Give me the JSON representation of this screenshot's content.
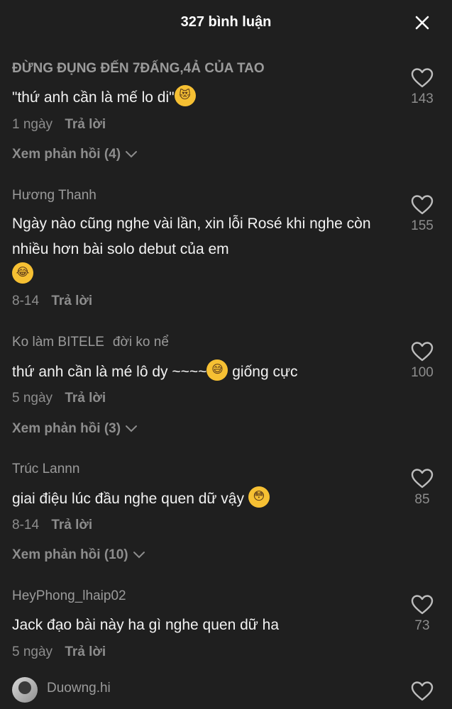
{
  "header": {
    "title": "327 bình luận"
  },
  "comments": [
    {
      "username": "ĐỪNG ĐỤNG ĐẾN 7ĐẤNG,4Ả CỦA TAO",
      "text": "\"thứ anh cần là mế lo di\"",
      "emoji": "heart-eyes-cat-emoji",
      "date": "1 ngày",
      "reply_label": "Trả lời",
      "view_replies": "Xem phản hồi (4)",
      "likes": "143"
    },
    {
      "username": "Hương Thanh",
      "text": "Ngày nào cũng nghe vài lần, xin lỗi Rosé khi nghe còn nhiều hơn bài solo debut của em",
      "emoji": "tears-of-joy-emoji",
      "date": "8-14",
      "reply_label": "Trả lời",
      "likes": "155"
    },
    {
      "username": "Ko làm BITELE",
      "username_extra": "đời ko nể",
      "text_before": "thứ anh cần là mé lô dy ~~~~",
      "text_after": " giống cực",
      "emoji": "grinning-sweat-emoji",
      "date": "5 ngày",
      "reply_label": "Trả lời",
      "view_replies": "Xem phản hồi (3)",
      "likes": "100"
    },
    {
      "username": "Trúc Lannn",
      "text": "giai điệu lúc đầu nghe quen dữ vậy",
      "emoji": "flushed-face-emoji",
      "date": "8-14",
      "reply_label": "Trả lời",
      "view_replies": "Xem phản hồi (10)",
      "likes": "85"
    },
    {
      "username": "HeyPhong_lhaip02",
      "text": "Jack đạo bài này ha gì nghe quen dữ ha",
      "date": "5 ngày",
      "reply_label": "Trả lời",
      "likes": "73"
    },
    {
      "username": "Duowng.hi"
    }
  ]
}
